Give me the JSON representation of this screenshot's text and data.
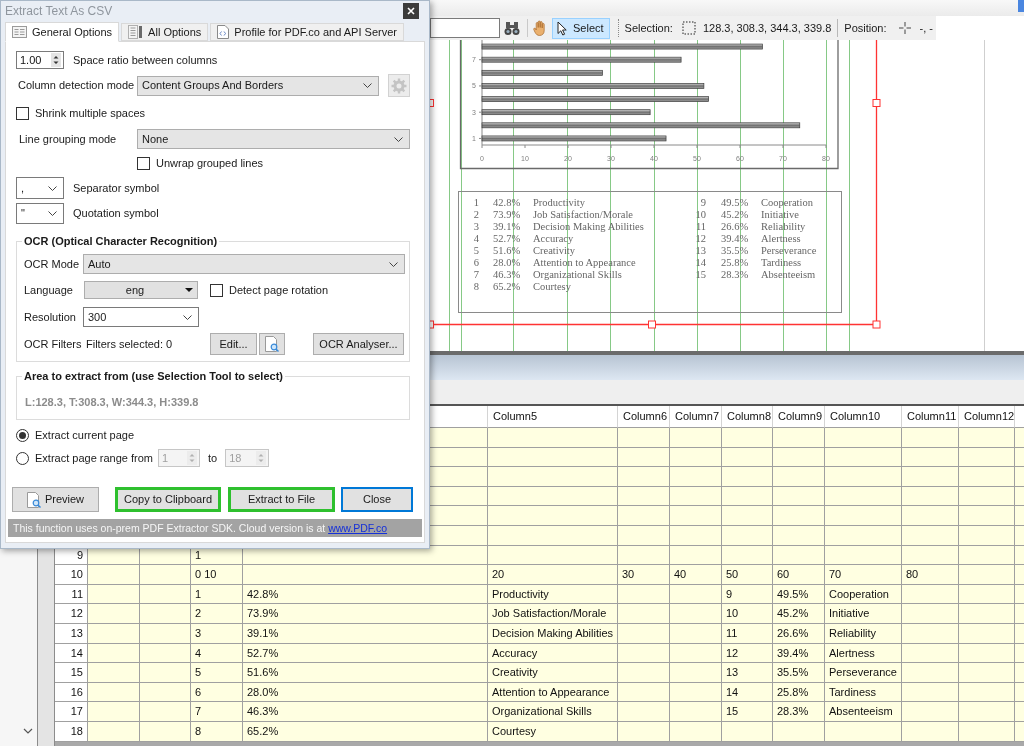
{
  "toolbar": {
    "tools": [
      {
        "kind": "pan",
        "selected": false
      },
      {
        "kind": "select",
        "label": "Select",
        "selected": true
      }
    ],
    "selection": {
      "label": "Selection:",
      "value": "128.3, 308.3, 344.3, 339.8"
    },
    "position": {
      "label": "Position:",
      "value": "-, -"
    }
  },
  "page": {
    "chart_data": {
      "type": "bar",
      "orientation": "horizontal",
      "x": [
        1,
        2,
        3,
        4,
        5,
        6,
        7,
        8
      ],
      "values": [
        42.8,
        73.9,
        39.1,
        52.7,
        51.6,
        28.0,
        46.3,
        65.2
      ],
      "xlim": [
        0,
        80
      ],
      "xticks": [
        0,
        10,
        20,
        30,
        40,
        50,
        60,
        70,
        80
      ],
      "ylim": [
        0.5,
        8.5
      ],
      "yticks": [
        1,
        3,
        5,
        7
      ]
    },
    "legend": {
      "left": [
        {
          "number": "1",
          "percent": "42.8%",
          "label": "Productivity"
        },
        {
          "number": "2",
          "percent": "73.9%",
          "label": "Job Satisfaction/Morale"
        },
        {
          "number": "3",
          "percent": "39.1%",
          "label": "Decision Making Abilities"
        },
        {
          "number": "4",
          "percent": "52.7%",
          "label": "Accuracy"
        },
        {
          "number": "5",
          "percent": "51.6%",
          "label": "Creativity"
        },
        {
          "number": "6",
          "percent": "28.0%",
          "label": "Attention to Appearance"
        },
        {
          "number": "7",
          "percent": "46.3%",
          "label": "Organizational Skills"
        },
        {
          "number": "8",
          "percent": "65.2%",
          "label": "Courtesy"
        }
      ],
      "right": [
        {
          "number": "9",
          "percent": "49.5%",
          "label": "Cooperation"
        },
        {
          "number": "10",
          "percent": "45.2%",
          "label": "Initiative"
        },
        {
          "number": "11",
          "percent": "26.6%",
          "label": "Reliability"
        },
        {
          "number": "12",
          "percent": "39.4%",
          "label": "Alertness"
        },
        {
          "number": "13",
          "percent": "35.5%",
          "label": "Perseverance"
        },
        {
          "number": "14",
          "percent": "25.8%",
          "label": "Tardiness"
        },
        {
          "number": "15",
          "percent": "28.3%",
          "label": "Absenteeism"
        }
      ]
    }
  },
  "grid": {
    "columns": [
      "Column5",
      "Column6",
      "Column7",
      "Column8",
      "Column9",
      "Column10",
      "Column11",
      "Column12"
    ],
    "rows": [
      {
        "number": "9",
        "cells": {
          "column_3": "1"
        }
      },
      {
        "number": "10",
        "cells": {
          "column_3": "0 10",
          "column_5": "20",
          "column_6": "30",
          "column_7": "40",
          "column_8": "50",
          "column_9": "60",
          "column_10": "70",
          "column_11": "80"
        }
      },
      {
        "number": "11",
        "cells": {
          "column_3": "1",
          "column_4": "42.8%",
          "column_5": "Productivity",
          "column_8": "9",
          "column_9": "49.5%",
          "column_10": "Cooperation"
        }
      },
      {
        "number": "12",
        "cells": {
          "column_3": "2",
          "column_4": "73.9%",
          "column_5": "Job Satisfaction/Morale",
          "column_8": "10",
          "column_9": "45.2%",
          "column_10": "Initiative"
        }
      },
      {
        "number": "13",
        "cells": {
          "column_3": "3",
          "column_4": "39.1%",
          "column_5": "Decision Making Abilities",
          "column_8": "11",
          "column_9": "26.6%",
          "column_10": "Reliability"
        }
      },
      {
        "number": "14",
        "cells": {
          "column_3": "4",
          "column_4": "52.7%",
          "column_5": "Accuracy",
          "column_8": "12",
          "column_9": "39.4%",
          "column_10": "Alertness"
        }
      },
      {
        "number": "15",
        "cells": {
          "column_3": "5",
          "column_4": "51.6%",
          "column_5": "Creativity",
          "column_8": "13",
          "column_9": "35.5%",
          "column_10": "Perseverance"
        }
      },
      {
        "number": "16",
        "cells": {
          "column_3": "6",
          "column_4": "28.0%",
          "column_5": "Attention to Appearance",
          "column_8": "14",
          "column_9": "25.8%",
          "column_10": "Tardiness"
        }
      },
      {
        "number": "17",
        "cells": {
          "column_3": "7",
          "column_4": "46.3%",
          "column_5": "Organizational Skills",
          "column_8": "15",
          "column_9": "28.3%",
          "column_10": "Absenteeism"
        }
      },
      {
        "number": "18",
        "cells": {
          "column_3": "8",
          "column_4": "65.2%",
          "column_5": "Courtesy"
        }
      }
    ]
  },
  "dialog": {
    "title": "Extract Text As CSV",
    "tabs": [
      {
        "label": "General Options",
        "selected": true
      },
      {
        "label": "All Options",
        "selected": false
      },
      {
        "label": "Profile for PDF.co and API Server",
        "selected": false
      }
    ],
    "space_ratio": {
      "value": "1.00",
      "label": "Space ratio between columns",
      "disabled": false
    },
    "column_detection": {
      "label": "Column detection mode",
      "value": "Content Groups And Borders",
      "settings_button": {
        "disabled": true
      }
    },
    "shrink_spaces": {
      "label": "Shrink multiple spaces",
      "checked": false
    },
    "line_grouping": {
      "label": "Line grouping mode",
      "value": "None"
    },
    "unwrap_lines": {
      "label": "Unwrap grouped lines",
      "checked": false
    },
    "separator": {
      "value": ",",
      "label": "Separator symbol"
    },
    "quotation": {
      "value": "\"",
      "label": "Quotation symbol"
    },
    "ocr": {
      "title": "OCR (Optical Character Recognition)",
      "mode": {
        "label": "OCR Mode",
        "value": "Auto"
      },
      "language": {
        "label": "Language",
        "value": "eng"
      },
      "detect_rotation": {
        "label": "Detect page rotation",
        "checked": false
      },
      "resolution": {
        "label": "Resolution",
        "value": "300"
      },
      "filters": {
        "label": "OCR Filters",
        "summary": "Filters selected: 0",
        "edit_button": "Edit...",
        "analyser_button": "OCR Analyser..."
      }
    },
    "area": {
      "title": "Area to extract from (use Selection Tool to select)",
      "value": "L:128.3, T:308.3, W:344.3, H:339.8"
    },
    "page_choice": [
      {
        "label": "Extract current page",
        "selected": true
      },
      {
        "label": "Extract page range from",
        "selected": false
      }
    ],
    "page_range": {
      "from": {
        "value": "1",
        "disabled": true
      },
      "to_label": "to",
      "to": {
        "value": "18",
        "disabled": true
      }
    },
    "buttons": [
      {
        "label": "Preview",
        "kind": "icon",
        "highlighted": false,
        "focused": false
      },
      {
        "label": "Copy to Clipboard",
        "kind": "text",
        "highlighted": true,
        "focused": false
      },
      {
        "label": "Extract to File",
        "kind": "text",
        "highlighted": true,
        "focused": false
      },
      {
        "label": "Close",
        "kind": "text",
        "highlighted": false,
        "focused": true
      }
    ],
    "footer": {
      "text": "This function uses on-prem PDF Extractor SDK. Cloud version is at",
      "link": "www.PDF.co"
    }
  }
}
